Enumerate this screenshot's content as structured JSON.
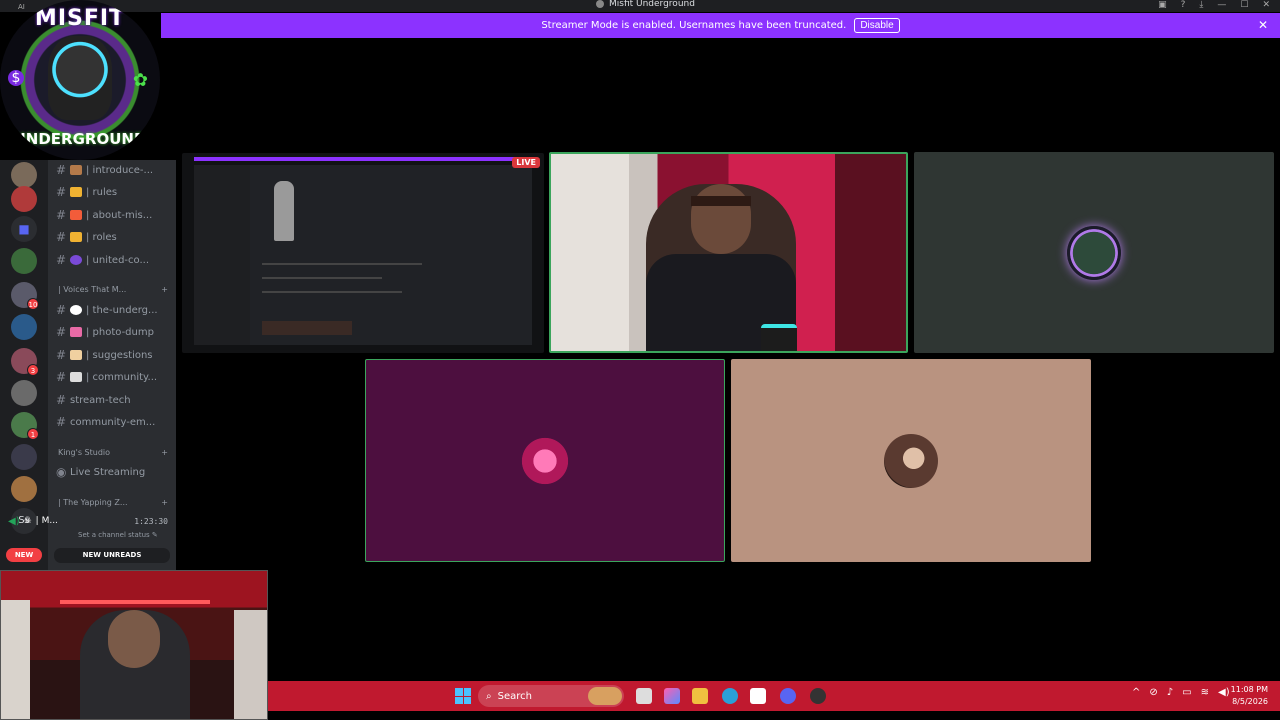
{
  "window": {
    "title": "Misfit Underground",
    "ai_label": "AI"
  },
  "banner": {
    "message": "Streamer Mode is enabled. Usernames have been truncated.",
    "disable_label": "Disable"
  },
  "logo": {
    "line1": "MISFIT",
    "line2": "UNDERGROUND"
  },
  "channels": [
    {
      "name": "| introduce-...",
      "emoji_color": "#b47a4a"
    },
    {
      "name": "| rules",
      "emoji_color": "#f0b232"
    },
    {
      "name": "| about-mis...",
      "emoji_color": "#f25c3a"
    },
    {
      "name": "| roles",
      "emoji_color": "#f0b232"
    },
    {
      "name": "| united-co...",
      "emoji_color": "#7a4ad8"
    }
  ],
  "category_voices": "| Voices That M...",
  "channels2": [
    {
      "name": "| the-underg...",
      "emoji_color": "#ffffff"
    },
    {
      "name": "| photo-dump",
      "emoji_color": "#e86aa6"
    },
    {
      "name": "| suggestions",
      "emoji_color": "#f0d0a0"
    },
    {
      "name": "| community...",
      "emoji_color": "#ddd"
    },
    {
      "name": "stream-tech",
      "emoji_color": ""
    },
    {
      "name": "community-em...",
      "emoji_color": ""
    }
  ],
  "category_kings": "King's Studio",
  "live_streaming": "Live Streaming",
  "category_yapping": "| The Yapping Z...",
  "voice": {
    "name": "| M...",
    "time": "1:23:30",
    "status": "Set a channel status"
  },
  "new_unreads": "NEW UNREADS",
  "new_pill": "NEW",
  "server_text": "Ss",
  "server_badges": [
    "10",
    "3",
    "1"
  ],
  "live_badge": "LIVE",
  "taskbar": {
    "search_placeholder": "Search",
    "time": "11:08 PM",
    "date": "8/5/2026"
  },
  "colors": {
    "banner": "#8c32ff",
    "taskbar": "#c0192f",
    "tile_gray": "#2f3633",
    "tile_purple": "#4d0f3f",
    "tile_tan": "#b99380",
    "speaking": "#3ba55c"
  }
}
